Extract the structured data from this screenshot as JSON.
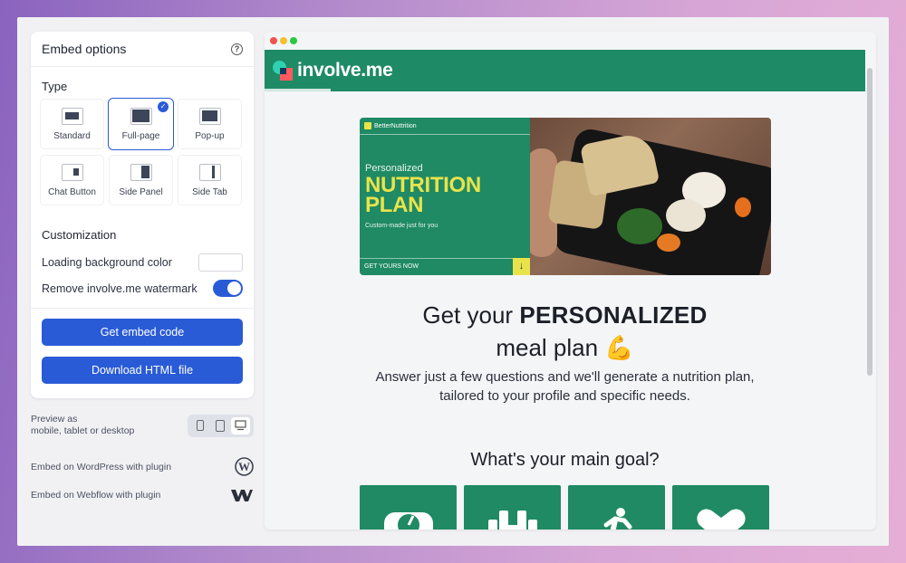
{
  "panel": {
    "title": "Embed options",
    "type_heading": "Type",
    "types": [
      {
        "label": "Standard",
        "selected": false
      },
      {
        "label": "Full-page",
        "selected": true
      },
      {
        "label": "Pop-up",
        "selected": false
      },
      {
        "label": "Chat Button",
        "selected": false
      },
      {
        "label": "Side Panel",
        "selected": false
      },
      {
        "label": "Side Tab",
        "selected": false
      }
    ],
    "customization_heading": "Customization",
    "loading_bg_label": "Loading background color",
    "loading_bg_color": "#ffffff",
    "watermark_label": "Remove involve.me watermark",
    "watermark_on": true,
    "get_code_label": "Get embed code",
    "download_label": "Download HTML file"
  },
  "side": {
    "preview_line1": "Preview as",
    "preview_line2": "mobile, tablet or desktop",
    "active_device": "desktop",
    "wordpress_label": "Embed on WordPress with plugin",
    "webflow_label": "Embed on Webflow with plugin"
  },
  "preview": {
    "brand_name": "involve.me",
    "progress_percent": 11,
    "hero": {
      "brand": "BetterNuttrition",
      "sub": "Personalized",
      "big_line1": "NUTRITION",
      "big_line2": "PLAN",
      "tagline": "Custom-made just for you",
      "cta": "GET YOURS NOW"
    },
    "headline_pre": "Get your ",
    "headline_bold": "PERSONALIZED",
    "headline_line2": "meal plan 💪",
    "description": "Answer just a few questions and we'll generate a nutrition plan, tailored to your profile and specific needs.",
    "question": "What's your main goal?",
    "goal_icons": [
      "scale-icon",
      "dumbbell-icon",
      "running-icon",
      "heart-icon"
    ]
  },
  "colors": {
    "accent": "#2a5bd7",
    "brand_green": "#1e8a66",
    "hero_yellow": "#e9e34b"
  }
}
